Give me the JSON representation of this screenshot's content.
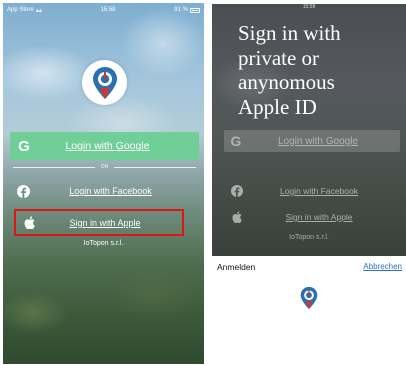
{
  "left_screen": {
    "status_bar": {
      "carrier": "App Store",
      "time": "15:58",
      "battery": "91 %"
    },
    "buttons": {
      "google": {
        "mark": "G",
        "label": "Login with Google"
      },
      "separator": "OR",
      "facebook": {
        "label": "Login with Facebook",
        "icon": "facebook-icon"
      },
      "apple": {
        "label": "Sign in with Apple",
        "icon": "apple-icon"
      }
    },
    "company": "IoTopon s.r.l.",
    "highlight_color": "#e01616",
    "google_color": "#6fcf97"
  },
  "right_screen": {
    "status_time": "15:58",
    "overlay_text": "Sign in with\nprivate or\nanynomous\nApple ID",
    "buttons": {
      "google": {
        "mark": "G",
        "label": "Login with Google"
      },
      "facebook": {
        "label": "Login with Facebook"
      },
      "apple": {
        "label": "Sign in with Apple"
      }
    },
    "company": "IoTopon s.r.l.",
    "sheet": {
      "title": "Anmelden",
      "cancel": "Abbrechen"
    }
  }
}
